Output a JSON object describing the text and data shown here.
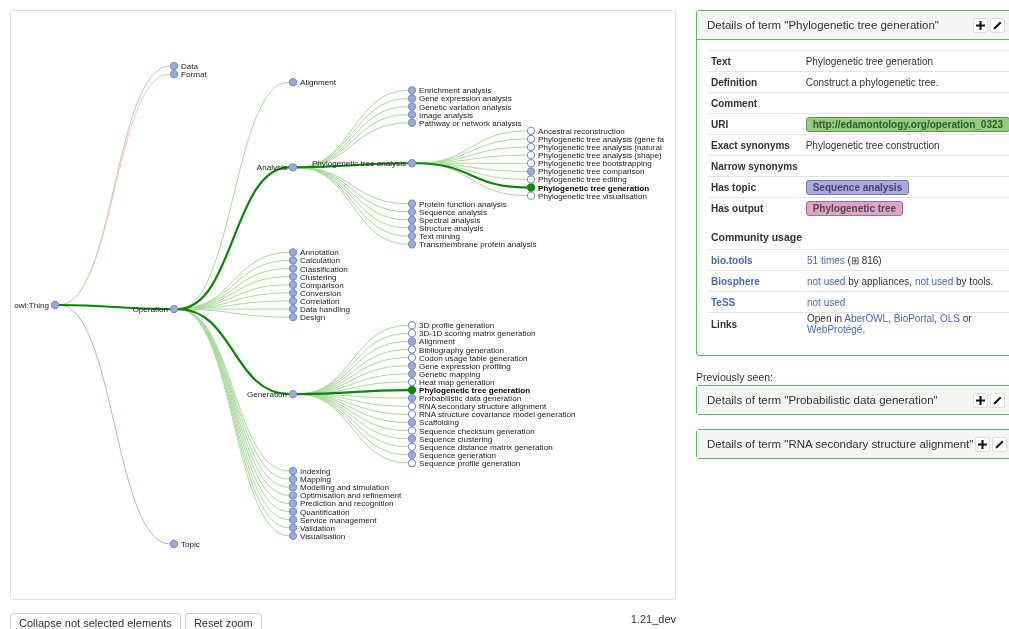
{
  "tree": {
    "label": "owl:Thing",
    "has_subterms": true,
    "selected": false,
    "children": [
      {
        "label": "Data",
        "has_subterms": true,
        "selected": false,
        "color": "#dcb4d2"
      },
      {
        "label": "Format",
        "has_subterms": true,
        "selected": false,
        "color": "#f6c9a8"
      },
      {
        "label": "Operation",
        "has_subterms": true,
        "selected": false,
        "color": "#a9d99d",
        "children": [
          {
            "label": "Alignment",
            "has_subterms": true,
            "selected": false
          },
          {
            "label": "Analysis",
            "has_subterms": true,
            "selected": false,
            "children": [
              {
                "label": "Enrichment analysis",
                "has_subterms": true,
                "selected": false
              },
              {
                "label": "Gene expression analysis",
                "has_subterms": true,
                "selected": false
              },
              {
                "label": "Genetic variation analysis",
                "has_subterms": true,
                "selected": false
              },
              {
                "label": "Image analysis",
                "has_subterms": true,
                "selected": false
              },
              {
                "label": "Pathway or network analysis",
                "has_subterms": true,
                "selected": false
              },
              {
                "label": "Phylogenetic tree analysis",
                "has_subterms": true,
                "selected": false,
                "children": [
                  {
                    "label": "Ancestral reconstruction",
                    "has_subterms": false,
                    "selected": false
                  },
                  {
                    "label": "Phylogenetic tree analysis (gene fa",
                    "has_subterms": false,
                    "selected": false
                  },
                  {
                    "label": "Phylogenetic tree analysis (natural",
                    "has_subterms": false,
                    "selected": false
                  },
                  {
                    "label": "Phylogenetic tree analysis (shape)",
                    "has_subterms": false,
                    "selected": false
                  },
                  {
                    "label": "Phylogenetic tree bootstrapping",
                    "has_subterms": false,
                    "selected": false
                  },
                  {
                    "label": "Phylogenetic tree comparison",
                    "has_subterms": true,
                    "selected": false
                  },
                  {
                    "label": "Phylogenetic tree editing",
                    "has_subterms": false,
                    "selected": false
                  },
                  {
                    "label": "Phylogenetic tree generation",
                    "has_subterms": false,
                    "selected": true
                  },
                  {
                    "label": "Phylogenetic tree visualisation",
                    "has_subterms": false,
                    "selected": false
                  }
                ]
              },
              {
                "label": "Protein function analysis",
                "has_subterms": true,
                "selected": false
              },
              {
                "label": "Sequence analysis",
                "has_subterms": true,
                "selected": false
              },
              {
                "label": "Spectral analysis",
                "has_subterms": true,
                "selected": false
              },
              {
                "label": "Structure analysis",
                "has_subterms": true,
                "selected": false
              },
              {
                "label": "Text mining",
                "has_subterms": true,
                "selected": false
              },
              {
                "label": "Transmembrane protein analysis",
                "has_subterms": true,
                "selected": false
              }
            ]
          },
          {
            "label": "Annotation",
            "has_subterms": true,
            "selected": false
          },
          {
            "label": "Calculation",
            "has_subterms": true,
            "selected": false
          },
          {
            "label": "Classification",
            "has_subterms": true,
            "selected": false
          },
          {
            "label": "Clustering",
            "has_subterms": true,
            "selected": false
          },
          {
            "label": "Comparison",
            "has_subterms": true,
            "selected": false
          },
          {
            "label": "Conversion",
            "has_subterms": true,
            "selected": false
          },
          {
            "label": "Correlation",
            "has_subterms": true,
            "selected": false
          },
          {
            "label": "Data handling",
            "has_subterms": true,
            "selected": false
          },
          {
            "label": "Design",
            "has_subterms": true,
            "selected": false
          },
          {
            "label": "Generation",
            "has_subterms": true,
            "selected": false,
            "children": [
              {
                "label": "3D profile generation",
                "has_subterms": false,
                "selected": false
              },
              {
                "label": "3D-1D scoring matrix generation",
                "has_subterms": false,
                "selected": false
              },
              {
                "label": "Alignment",
                "has_subterms": true,
                "selected": false
              },
              {
                "label": "Bibliography generation",
                "has_subterms": false,
                "selected": false
              },
              {
                "label": "Codon usage table generation",
                "has_subterms": false,
                "selected": false
              },
              {
                "label": "Gene expression profiling",
                "has_subterms": true,
                "selected": false
              },
              {
                "label": "Genetic mapping",
                "has_subterms": true,
                "selected": false
              },
              {
                "label": "Heat map generation",
                "has_subterms": false,
                "selected": false
              },
              {
                "label": "Phylogenetic tree generation",
                "has_subterms": false,
                "selected": true
              },
              {
                "label": "Probabilistic data generation",
                "has_subterms": true,
                "selected": false
              },
              {
                "label": "RNA secondary structure alignment",
                "has_subterms": false,
                "selected": false
              },
              {
                "label": "RNA structure covariance model generation",
                "has_subterms": false,
                "selected": false
              },
              {
                "label": "Scaffolding",
                "has_subterms": true,
                "selected": false
              },
              {
                "label": "Sequence checksum generation",
                "has_subterms": false,
                "selected": false
              },
              {
                "label": "Sequence clustering",
                "has_subterms": true,
                "selected": false
              },
              {
                "label": "Sequence distance matrix generation",
                "has_subterms": false,
                "selected": false
              },
              {
                "label": "Sequence generation",
                "has_subterms": true,
                "selected": false
              },
              {
                "label": "Sequence profile generation",
                "has_subterms": false,
                "selected": false
              }
            ]
          },
          {
            "label": "Indexing",
            "has_subterms": true,
            "selected": false
          },
          {
            "label": "Mapping",
            "has_subterms": true,
            "selected": false
          },
          {
            "label": "Modelling and simulation",
            "has_subterms": true,
            "selected": false
          },
          {
            "label": "Optimisation and refinement",
            "has_subterms": true,
            "selected": false
          },
          {
            "label": "Prediction and recognition",
            "has_subterms": true,
            "selected": false
          },
          {
            "label": "Quantification",
            "has_subterms": true,
            "selected": false
          },
          {
            "label": "Service management",
            "has_subterms": true,
            "selected": false
          },
          {
            "label": "Validation",
            "has_subterms": true,
            "selected": false
          },
          {
            "label": "Visualisation",
            "has_subterms": true,
            "selected": false
          }
        ]
      },
      {
        "label": "Topic",
        "has_subterms": true,
        "selected": false,
        "color": "#b3b3e3"
      }
    ]
  },
  "buttons": [
    "Collapse not selected elements",
    "Reset zoom"
  ],
  "version": "1.21_dev",
  "details": {
    "title": "Details of term \"Phylogenetic tree generation\"",
    "fields": [
      {
        "label": "Text",
        "kind": "text",
        "value": "Phylogenetic tree generation"
      },
      {
        "label": "Definition",
        "kind": "text",
        "value": "Construct a phylogenetic tree."
      },
      {
        "label": "Comment",
        "kind": "empty"
      },
      {
        "label": "URI",
        "kind": "badge",
        "value": "http://edamontology.org/operation_0323",
        "color": "#8fd07f"
      },
      {
        "label": "Exact synonyms",
        "kind": "text",
        "value": "Phylogenetic tree construction"
      },
      {
        "label": "Narrow synonyms",
        "kind": "empty"
      },
      {
        "label": "Has topic",
        "kind": "badge",
        "value": "Sequence analysis",
        "color": "#a9a9e4"
      },
      {
        "label": "Has output",
        "kind": "badge",
        "value": "Phylogenetic tree",
        "color": "#dda6c8"
      }
    ],
    "usage_heading": "Community usage",
    "usage": [
      {
        "label": "bio.tools",
        "link": true,
        "parts": [
          {
            "text": "51 times",
            "link": true
          },
          {
            "text": " (⊞ 816)",
            "link": false
          }
        ]
      },
      {
        "label": "Biosphere",
        "link": true,
        "parts": [
          {
            "text": "not used",
            "link": true
          },
          {
            "text": " by appliances, ",
            "link": false
          },
          {
            "text": "not used",
            "link": true
          },
          {
            "text": " by tools.",
            "link": false
          }
        ]
      },
      {
        "label": "TeSS",
        "link": true,
        "parts": [
          {
            "text": "not used",
            "link": true
          }
        ]
      },
      {
        "label": "Links",
        "link": false,
        "parts": [
          {
            "text": "Open in ",
            "link": false
          },
          {
            "text": "AberOWL",
            "link": true
          },
          {
            "text": ", ",
            "link": false
          },
          {
            "text": "BioPortal",
            "link": true
          },
          {
            "text": ", ",
            "link": false
          },
          {
            "text": "OLS",
            "link": true
          },
          {
            "text": " or ",
            "link": false
          },
          {
            "text": "WebProtégé",
            "link": true
          },
          {
            "text": ".",
            "link": false
          }
        ]
      }
    ]
  },
  "previously_seen": {
    "heading": "Previously seen:",
    "panels": [
      {
        "title": "Details of term \"Probabilistic data generation\""
      },
      {
        "title": "Details of term \"RNA secondary structure alignment\""
      }
    ]
  }
}
